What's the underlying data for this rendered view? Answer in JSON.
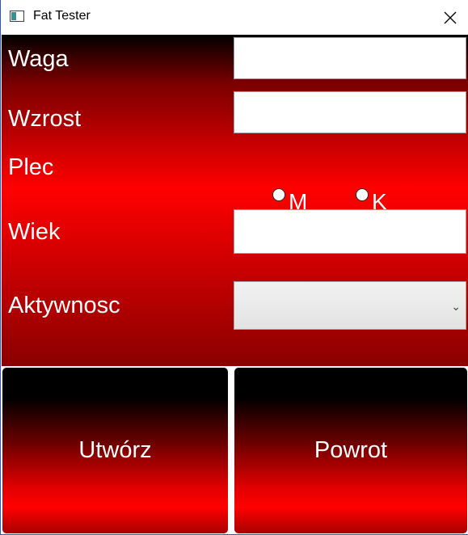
{
  "window": {
    "title": "Fat Tester"
  },
  "form": {
    "weight_label": "Waga",
    "height_label": "Wzrost",
    "sex_label": "Plec",
    "sex_options": [
      "M",
      "K"
    ],
    "age_label": "Wiek",
    "activity_label": "Aktywnosc",
    "activity_selected": ""
  },
  "buttons": {
    "create": "Utwórz",
    "back": "Powrot"
  },
  "colors": {
    "accent": "#ff0000",
    "dark": "#000000",
    "border": "#2b57c8"
  }
}
